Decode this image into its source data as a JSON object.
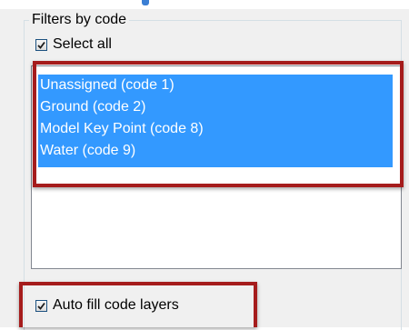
{
  "groupbox": {
    "title": "Filters by code"
  },
  "select_all": {
    "label": "Select all",
    "checked": true
  },
  "code_list": {
    "items": [
      {
        "label": "Unassigned (code 1)",
        "selected": true
      },
      {
        "label": "Ground (code 2)",
        "selected": true
      },
      {
        "label": "Model Key Point (code 8)",
        "selected": true
      },
      {
        "label": "Water (code 9)",
        "selected": true
      }
    ]
  },
  "auto_fill": {
    "label": "Auto fill code layers",
    "checked": true
  },
  "colors": {
    "selection": "#3399ff",
    "highlight_border": "#a51c1c",
    "checkmark": "#1a1a1a"
  }
}
